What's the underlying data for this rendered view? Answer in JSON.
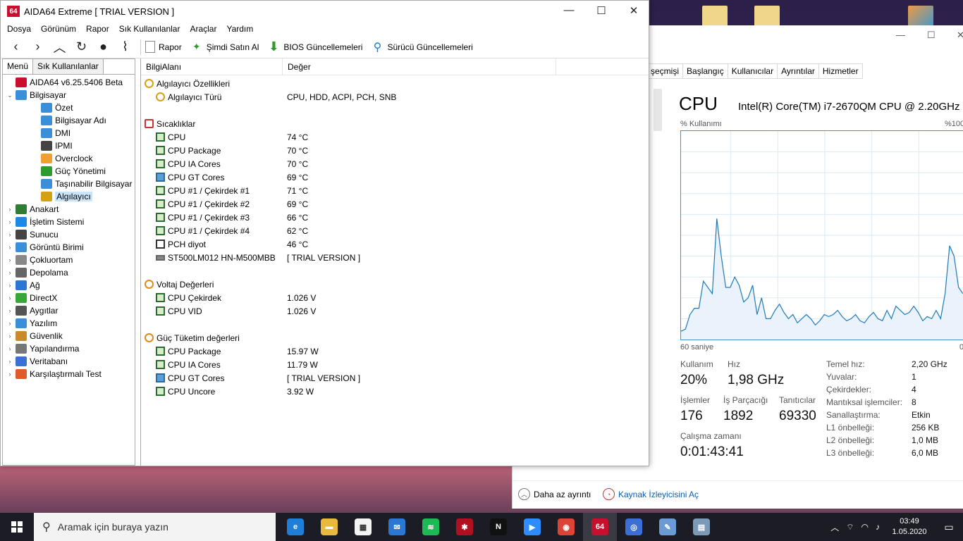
{
  "aida": {
    "window_title": "AIDA64 Extreme  [ TRIAL VERSION ]",
    "app_icon_text": "64",
    "controls": {
      "minimize": "—",
      "maximize": "☐",
      "close": "✕"
    },
    "menu": [
      "Dosya",
      "Görünüm",
      "Rapor",
      "Sık Kullanılanlar",
      "Araçlar",
      "Yardım"
    ],
    "toolbar": {
      "report": "Rapor",
      "buy": "Şimdi Satın Al",
      "bios": "BIOS Güncellemeleri",
      "drivers": "Sürücü Güncellemeleri"
    },
    "left_tabs": [
      "Menü",
      "Sık Kullanılanlar"
    ],
    "tree": {
      "root": "AIDA64 v6.25.5406 Beta",
      "computer": "Bilgisayar",
      "computer_children": [
        "Özet",
        "Bilgisayar Adı",
        "DMI",
        "IPMI",
        "Overclock",
        "Güç Yönetimi",
        "Taşınabilir Bilgisayar",
        "Algılayıcı"
      ],
      "others": [
        "Anakart",
        "İşletim Sistemi",
        "Sunucu",
        "Görüntü Birimi",
        "Çokluortam",
        "Depolama",
        "Ağ",
        "DirectX",
        "Aygıtlar",
        "Yazılım",
        "Güvenlik",
        "Yapılandırma",
        "Veritabanı",
        "Karşılaştırmalı Test"
      ]
    },
    "columns": {
      "field": "BilgiAlanı",
      "value": "Değer"
    },
    "sections": [
      {
        "title": "Algılayıcı Özellikleri",
        "icon": "sensor-icon",
        "rows": [
          {
            "f": "Algılayıcı Türü",
            "v": "CPU, HDD, ACPI, PCH, SNB",
            "icon": "gauge"
          }
        ]
      },
      {
        "title": "Sıcaklıklar",
        "icon": "thermometer-icon",
        "rows": [
          {
            "f": "CPU",
            "v": "74 °C",
            "icon": "chip"
          },
          {
            "f": "CPU Package",
            "v": "70 °C",
            "icon": "chip"
          },
          {
            "f": "CPU IA Cores",
            "v": "70 °C",
            "icon": "chip"
          },
          {
            "f": "CPU GT Cores",
            "v": "69 °C",
            "icon": "gpu"
          },
          {
            "f": "CPU #1 / Çekirdek #1",
            "v": "71 °C",
            "icon": "chip"
          },
          {
            "f": "CPU #1 / Çekirdek #2",
            "v": "69 °C",
            "icon": "chip"
          },
          {
            "f": "CPU #1 / Çekirdek #3",
            "v": "66 °C",
            "icon": "chip"
          },
          {
            "f": "CPU #1 / Çekirdek #4",
            "v": "62 °C",
            "icon": "chip"
          },
          {
            "f": "PCH diyot",
            "v": "46 °C",
            "icon": "pch"
          },
          {
            "f": "ST500LM012 HN-M500MBB",
            "v": "[ TRIAL VERSION ]",
            "icon": "disk"
          }
        ]
      },
      {
        "title": "Voltaj Değerleri",
        "icon": "voltage-icon",
        "rows": [
          {
            "f": "CPU Çekirdek",
            "v": "1.026 V",
            "icon": "chip"
          },
          {
            "f": "CPU VID",
            "v": "1.026 V",
            "icon": "chip"
          }
        ]
      },
      {
        "title": "Güç Tüketim değerleri",
        "icon": "power-icon",
        "rows": [
          {
            "f": "CPU Package",
            "v": "15.97 W",
            "icon": "chip"
          },
          {
            "f": "CPU IA Cores",
            "v": "11.79 W",
            "icon": "chip"
          },
          {
            "f": "CPU GT Cores",
            "v": "[ TRIAL VERSION ]",
            "icon": "gpu"
          },
          {
            "f": "CPU Uncore",
            "v": "3.92 W",
            "icon": "chip"
          }
        ]
      }
    ]
  },
  "taskmgr": {
    "tabs": [
      "şeçmişi",
      "Başlangıç",
      "Kullanıcılar",
      "Ayrıntılar",
      "Hizmetler"
    ],
    "title": "CPU",
    "model": "Intel(R) Core(TM) i7-2670QM CPU @ 2.20GHz",
    "usage_label": "% Kullanımı",
    "max_label": "%100",
    "time_label": "60 saniye",
    "zero_label": "0",
    "graph_values": [
      4,
      5,
      12,
      15,
      15,
      28,
      25,
      22,
      58,
      40,
      25,
      25,
      30,
      26,
      18,
      20,
      26,
      12,
      20,
      10,
      10,
      14,
      17,
      13,
      10,
      12,
      8,
      10,
      12,
      10,
      7,
      9,
      12,
      11,
      12,
      14,
      11,
      9,
      10,
      12,
      9,
      8,
      11,
      13,
      10,
      9,
      14,
      10,
      16,
      14,
      12,
      13,
      16,
      13,
      9,
      11,
      10,
      14,
      10,
      22,
      45,
      40,
      25,
      22
    ],
    "stats": {
      "usage_label": "Kullanım",
      "usage": "20%",
      "speed_label": "Hız",
      "speed": "1,98 GHz",
      "proc_label": "İşlemler",
      "proc": "176",
      "threads_label": "İş Parçacığı",
      "threads": "1892",
      "handles_label": "Tanıtıcılar",
      "handles": "69330",
      "uptime_label": "Çalışma zamanı",
      "uptime": "0:01:43:41"
    },
    "specs": [
      {
        "k": "Temel hız:",
        "v": "2,20 GHz"
      },
      {
        "k": "Yuvalar:",
        "v": "1"
      },
      {
        "k": "Çekirdekler:",
        "v": "4"
      },
      {
        "k": "Mantıksal işlemciler:",
        "v": "8"
      },
      {
        "k": "Sanallaştırma:",
        "v": "Etkin"
      },
      {
        "k": "L1 önbelleği:",
        "v": "256 KB"
      },
      {
        "k": "L2 önbelleği:",
        "v": "1,0 MB"
      },
      {
        "k": "L3 önbelleği:",
        "v": "6,0 MB"
      }
    ],
    "footer": {
      "less": "Daha az ayrıntı",
      "monitor": "Kaynak İzleyicisini Aç"
    }
  },
  "taskbar": {
    "search_placeholder": "Aramak için buraya yazın",
    "apps": [
      {
        "name": "edge",
        "color": "#1f7fd8",
        "glyph": "e"
      },
      {
        "name": "explorer",
        "color": "#e8b93a",
        "glyph": "▬"
      },
      {
        "name": "store",
        "color": "#f3f3f3",
        "glyph": "▦"
      },
      {
        "name": "mail",
        "color": "#2a78d4",
        "glyph": "✉"
      },
      {
        "name": "spotify",
        "color": "#1db954",
        "glyph": "≋"
      },
      {
        "name": "app-red",
        "color": "#b01020",
        "glyph": "✱"
      },
      {
        "name": "netflix",
        "color": "#111111",
        "glyph": "N"
      },
      {
        "name": "zoom",
        "color": "#2d8cff",
        "glyph": "▶"
      },
      {
        "name": "chrome",
        "color": "#db4437",
        "glyph": "◉"
      },
      {
        "name": "aida64",
        "color": "#c8102e",
        "glyph": "64"
      },
      {
        "name": "browser-blue",
        "color": "#3b6fd6",
        "glyph": "◎"
      },
      {
        "name": "paint",
        "color": "#6a9bd4",
        "glyph": "✎"
      },
      {
        "name": "taskmgr",
        "color": "#7a9ab8",
        "glyph": "▤"
      }
    ],
    "time": "03:49",
    "date": "1.05.2020"
  }
}
